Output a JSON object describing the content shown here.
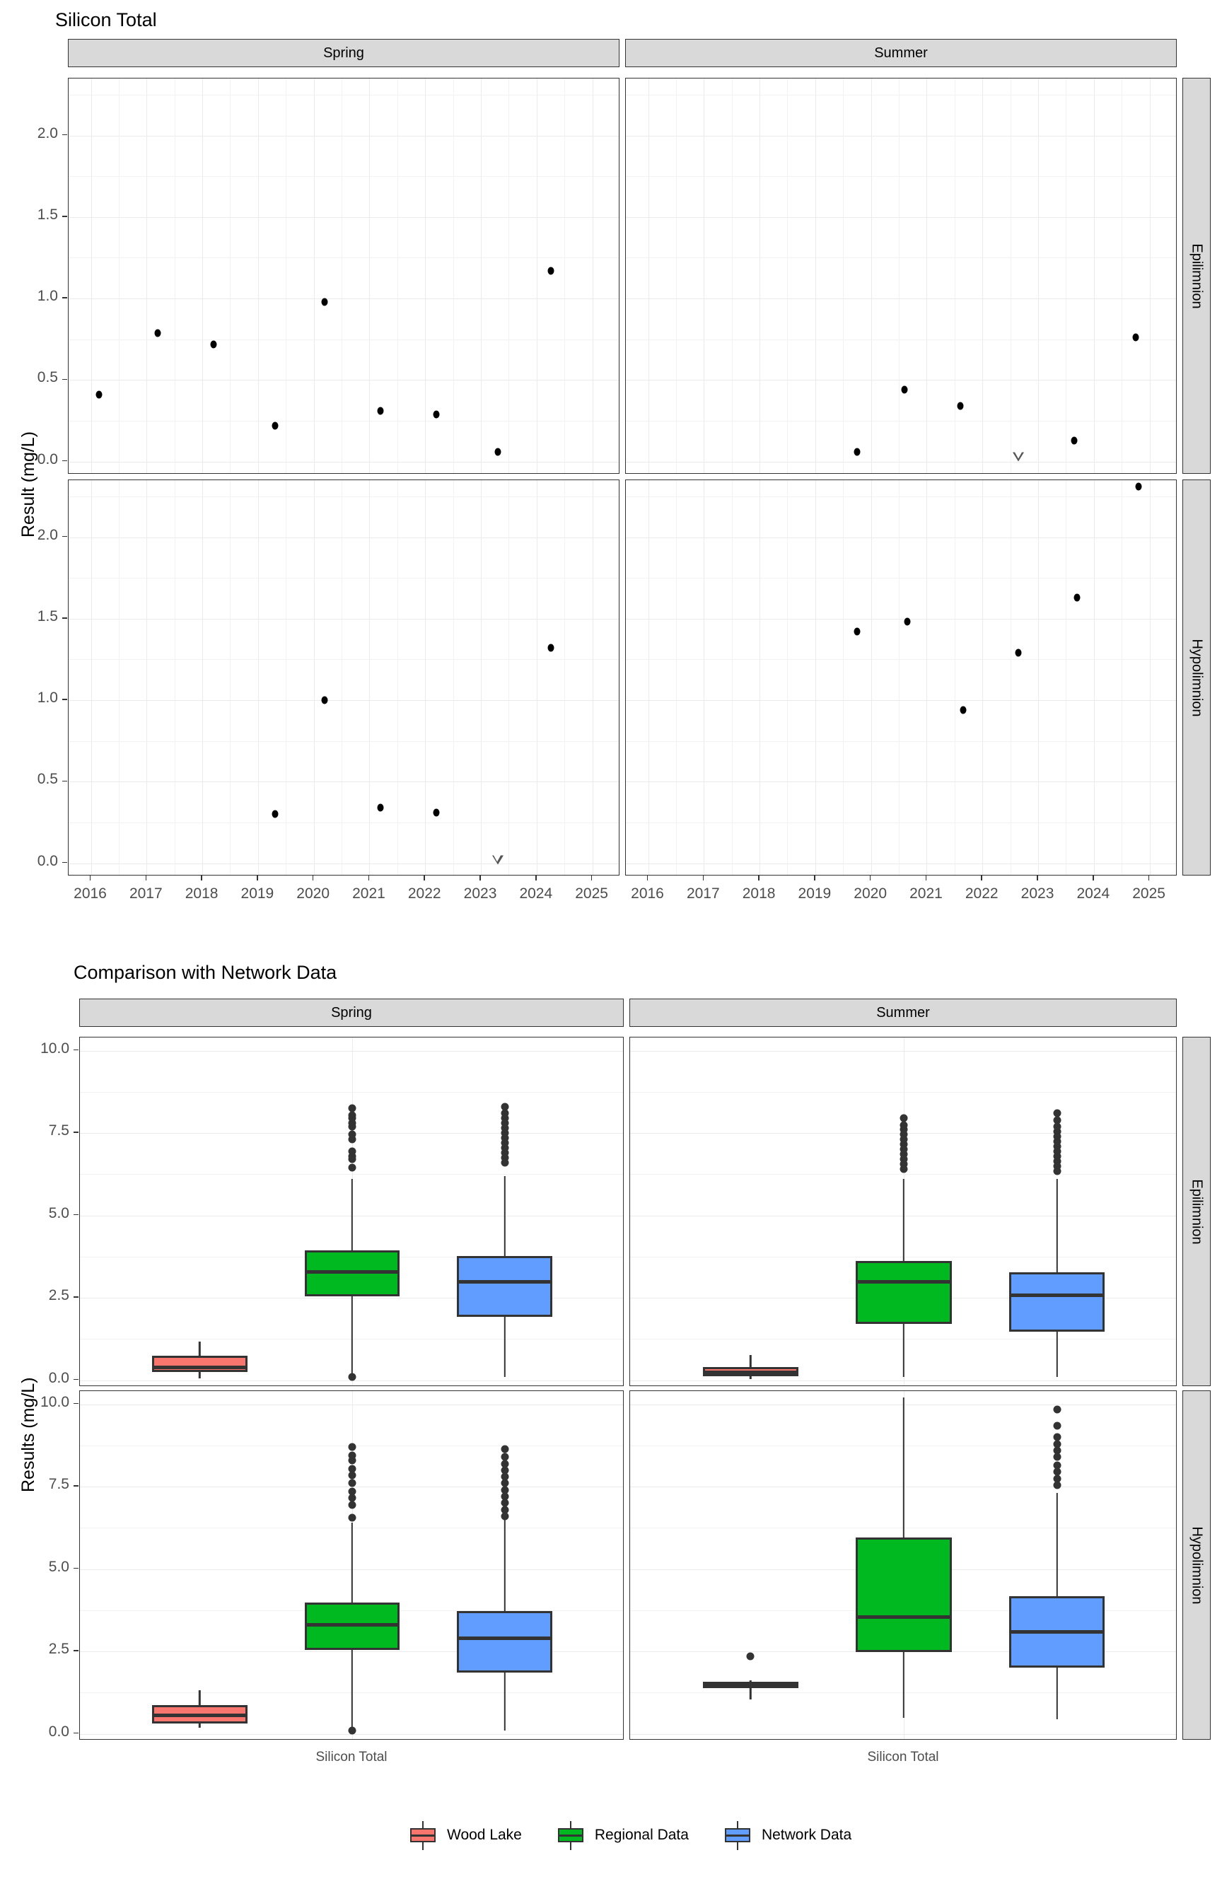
{
  "figure1": {
    "title": "Silicon Total",
    "ylabel": "Result (mg/L)",
    "col_strips": [
      "Spring",
      "Summer"
    ],
    "row_strips": [
      "Epilimnion",
      "Hypolimnion"
    ],
    "yticks": [
      "0.0",
      "0.5",
      "1.0",
      "1.5",
      "2.0"
    ],
    "xticks": [
      "2016",
      "2017",
      "2018",
      "2019",
      "2020",
      "2021",
      "2022",
      "2023",
      "2024",
      "2025"
    ]
  },
  "figure2": {
    "title": "Comparison with Network Data",
    "ylabel": "Results (mg/L)",
    "col_strips": [
      "Spring",
      "Summer"
    ],
    "row_strips": [
      "Epilimnion",
      "Hypolimnion"
    ],
    "yticks": [
      "0.0",
      "2.5",
      "5.0",
      "7.5",
      "10.0"
    ],
    "xtick": "Silicon Total"
  },
  "legend": {
    "items": [
      {
        "label": "Wood Lake",
        "color": "#F8766D"
      },
      {
        "label": "Regional Data",
        "color": "#00B81F"
      },
      {
        "label": "Network Data",
        "color": "#619CFF"
      }
    ]
  },
  "chart_data": [
    {
      "type": "scatter",
      "title": "Silicon Total",
      "xlabel": "",
      "ylabel": "Result (mg/L)",
      "xlim": [
        2015.6,
        2025.5
      ],
      "ylim": [
        -0.08,
        2.35
      ],
      "grid": true,
      "facet_col": "Season",
      "facet_row": "Depth Layer",
      "panels": [
        {
          "col": "Spring",
          "row": "Epilimnion",
          "points": [
            {
              "x": 2016.15,
              "y": 0.41
            },
            {
              "x": 2017.2,
              "y": 0.79
            },
            {
              "x": 2018.2,
              "y": 0.72
            },
            {
              "x": 2019.3,
              "y": 0.22
            },
            {
              "x": 2020.2,
              "y": 0.98
            },
            {
              "x": 2021.2,
              "y": 0.31
            },
            {
              "x": 2022.2,
              "y": 0.29
            },
            {
              "x": 2023.3,
              "y": 0.06
            },
            {
              "x": 2024.25,
              "y": 1.17
            }
          ],
          "censored": []
        },
        {
          "col": "Summer",
          "row": "Epilimnion",
          "points": [
            {
              "x": 2019.75,
              "y": 0.06
            },
            {
              "x": 2020.6,
              "y": 0.44
            },
            {
              "x": 2021.6,
              "y": 0.34
            },
            {
              "x": 2023.65,
              "y": 0.13
            },
            {
              "x": 2024.75,
              "y": 0.76
            }
          ],
          "censored": [
            {
              "x": 2022.65,
              "y": 0.03
            }
          ]
        },
        {
          "col": "Spring",
          "row": "Hypolimnion",
          "points": [
            {
              "x": 2019.3,
              "y": 0.3
            },
            {
              "x": 2020.2,
              "y": 1.0
            },
            {
              "x": 2021.2,
              "y": 0.34
            },
            {
              "x": 2022.2,
              "y": 0.31
            },
            {
              "x": 2024.25,
              "y": 1.32
            }
          ],
          "censored": [
            {
              "x": 2023.3,
              "y": 0.02
            }
          ]
        },
        {
          "col": "Summer",
          "row": "Hypolimnion",
          "points": [
            {
              "x": 2019.75,
              "y": 1.42
            },
            {
              "x": 2020.65,
              "y": 1.48
            },
            {
              "x": 2021.65,
              "y": 0.94
            },
            {
              "x": 2022.65,
              "y": 1.29
            },
            {
              "x": 2023.7,
              "y": 1.63
            },
            {
              "x": 2024.8,
              "y": 2.31
            }
          ],
          "censored": []
        }
      ]
    },
    {
      "type": "boxplot",
      "title": "Comparison with Network Data",
      "xlabel": "Silicon Total",
      "ylabel": "Results (mg/L)",
      "ylim": [
        -0.2,
        10.4
      ],
      "grid": true,
      "facet_col": "Season",
      "facet_row": "Depth Layer",
      "groups": [
        "Wood Lake",
        "Regional Data",
        "Network Data"
      ],
      "panels": [
        {
          "col": "Spring",
          "row": "Epilimnion",
          "boxes": [
            {
              "group": "Wood Lake",
              "lower_whisker": 0.06,
              "q1": 0.25,
              "median": 0.4,
              "q3": 0.75,
              "upper_whisker": 1.17,
              "outliers": []
            },
            {
              "group": "Regional Data",
              "lower_whisker": 0.1,
              "q1": 2.55,
              "median": 3.28,
              "q3": 3.95,
              "upper_whisker": 6.1,
              "outliers": [
                8.25,
                8.05,
                7.95,
                7.8,
                7.7,
                7.45,
                7.3,
                6.95,
                6.8,
                6.7,
                6.45,
                0.1
              ]
            },
            {
              "group": "Network Data",
              "lower_whisker": 0.1,
              "q1": 1.92,
              "median": 2.98,
              "q3": 3.78,
              "upper_whisker": 6.2,
              "outliers": [
                8.3,
                8.1,
                7.95,
                7.8,
                7.65,
                7.5,
                7.35,
                7.2,
                7.05,
                6.9,
                6.75,
                6.6
              ]
            }
          ]
        },
        {
          "col": "Summer",
          "row": "Epilimnion",
          "boxes": [
            {
              "group": "Wood Lake",
              "lower_whisker": 0.03,
              "q1": 0.12,
              "median": 0.24,
              "q3": 0.4,
              "upper_whisker": 0.76,
              "outliers": []
            },
            {
              "group": "Regional Data",
              "lower_whisker": 0.1,
              "q1": 1.72,
              "median": 2.98,
              "q3": 3.62,
              "upper_whisker": 6.1,
              "outliers": [
                7.95,
                7.75,
                7.6,
                7.45,
                7.3,
                7.15,
                7.0,
                6.85,
                6.7,
                6.55,
                6.4
              ]
            },
            {
              "group": "Network Data",
              "lower_whisker": 0.1,
              "q1": 1.48,
              "median": 2.58,
              "q3": 3.28,
              "upper_whisker": 6.1,
              "outliers": [
                8.1,
                7.9,
                7.7,
                7.55,
                7.4,
                7.25,
                7.1,
                6.95,
                6.8,
                6.65,
                6.5,
                6.35
              ]
            }
          ]
        },
        {
          "col": "Spring",
          "row": "Hypolimnion",
          "boxes": [
            {
              "group": "Wood Lake",
              "lower_whisker": 0.18,
              "q1": 0.31,
              "median": 0.56,
              "q3": 0.88,
              "upper_whisker": 1.32,
              "outliers": []
            },
            {
              "group": "Regional Data",
              "lower_whisker": 0.1,
              "q1": 2.55,
              "median": 3.3,
              "q3": 3.98,
              "upper_whisker": 6.4,
              "outliers": [
                8.7,
                8.45,
                8.3,
                8.05,
                7.85,
                7.6,
                7.35,
                7.15,
                6.95,
                6.55,
                0.1
              ]
            },
            {
              "group": "Network Data",
              "lower_whisker": 0.1,
              "q1": 1.85,
              "median": 2.9,
              "q3": 3.72,
              "upper_whisker": 6.55,
              "outliers": [
                8.65,
                8.4,
                8.2,
                8.0,
                7.8,
                7.6,
                7.4,
                7.2,
                7.0,
                6.8,
                6.6
              ]
            }
          ]
        },
        {
          "col": "Summer",
          "row": "Hypolimnion",
          "boxes": [
            {
              "group": "Wood Lake",
              "lower_whisker": 1.04,
              "q1": 1.38,
              "median": 1.48,
              "q3": 1.58,
              "upper_whisker": 1.62,
              "outliers": [
                2.36
              ]
            },
            {
              "group": "Regional Data",
              "lower_whisker": 0.48,
              "q1": 2.48,
              "median": 3.55,
              "q3": 5.95,
              "upper_whisker": 10.2,
              "outliers": []
            },
            {
              "group": "Network Data",
              "lower_whisker": 0.45,
              "q1": 2.0,
              "median": 3.1,
              "q3": 4.18,
              "upper_whisker": 7.3,
              "outliers": [
                9.85,
                9.35,
                9.0,
                8.8,
                8.6,
                8.4,
                8.15,
                7.95,
                7.75,
                7.55
              ]
            }
          ]
        }
      ]
    }
  ]
}
